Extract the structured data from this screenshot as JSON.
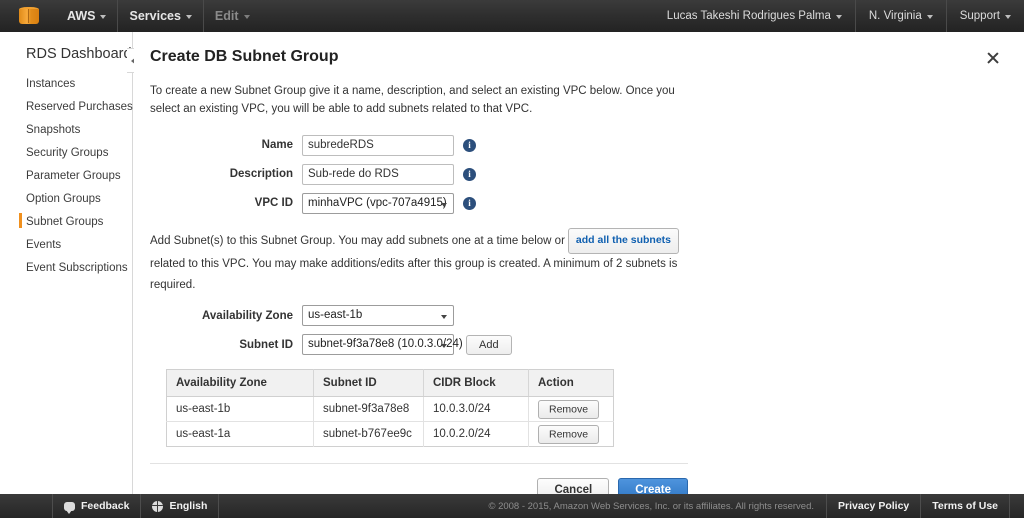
{
  "topnav": {
    "logo_icon": "aws-cube-icon",
    "left_items": [
      {
        "label": "AWS",
        "dim": false
      },
      {
        "label": "Services",
        "dim": false
      },
      {
        "label": "Edit",
        "dim": true
      }
    ],
    "right_items": [
      {
        "label": "Lucas Takeshi Rodrigues Palma"
      },
      {
        "label": "N. Virginia"
      },
      {
        "label": "Support"
      }
    ]
  },
  "sidebar": {
    "title": "RDS Dashboard",
    "collapse_icon": "chevron-left-icon",
    "items": [
      {
        "label": "Instances",
        "active": false
      },
      {
        "label": "Reserved Purchases",
        "active": false
      },
      {
        "label": "Snapshots",
        "active": false
      },
      {
        "label": "Security Groups",
        "active": false
      },
      {
        "label": "Parameter Groups",
        "active": false
      },
      {
        "label": "Option Groups",
        "active": false
      },
      {
        "label": "Subnet Groups",
        "active": true
      },
      {
        "label": "Events",
        "active": false
      },
      {
        "label": "Event Subscriptions",
        "active": false
      }
    ],
    "accent_color": "#f0901e"
  },
  "main": {
    "title": "Create DB Subnet Group",
    "close_icon": "close-icon",
    "intro": "To create a new Subnet Group give it a name, description, and select an existing VPC below. Once you select an existing VPC, you will be able to add subnets related to that VPC.",
    "form": {
      "name": {
        "label": "Name",
        "value": "subredeRDS",
        "info_icon": "info-icon"
      },
      "description": {
        "label": "Description",
        "value": "Sub-rede do RDS",
        "info_icon": "info-icon"
      },
      "vpc_id": {
        "label": "VPC ID",
        "value": "minhaVPC (vpc-707a4915)",
        "info_icon": "info-icon"
      }
    },
    "subnet_note_part1": "Add Subnet(s) to this Subnet Group. You may add subnets one at a time below or",
    "add_all_button": "add all the subnets",
    "subnet_note_part2": "related to this VPC. You may make additions/edits after this group is created. A minimum of 2 subnets is required.",
    "availability_zone": {
      "label": "Availability Zone",
      "value": "us-east-1b"
    },
    "subnet_id": {
      "label": "Subnet ID",
      "value": "subnet-9f3a78e8 (10.0.3.0/24)"
    },
    "add_button": "Add",
    "table": {
      "columns": [
        "Availability Zone",
        "Subnet ID",
        "CIDR Block",
        "Action"
      ],
      "rows": [
        {
          "az": "us-east-1b",
          "subnet": "subnet-9f3a78e8",
          "cidr": "10.0.3.0/24",
          "action": "Remove"
        },
        {
          "az": "us-east-1a",
          "subnet": "subnet-b767ee9c",
          "cidr": "10.0.2.0/24",
          "action": "Remove"
        }
      ]
    },
    "cancel_button": "Cancel",
    "create_button": "Create",
    "create_color": "#3f86cf"
  },
  "footer": {
    "feedback": "Feedback",
    "feedback_icon": "speech-bubble-icon",
    "language": "English",
    "language_icon": "globe-icon",
    "copyright": "© 2008 - 2015, Amazon Web Services, Inc. or its affiliates. All rights reserved.",
    "privacy_policy": "Privacy Policy",
    "terms_of_use": "Terms of Use"
  }
}
